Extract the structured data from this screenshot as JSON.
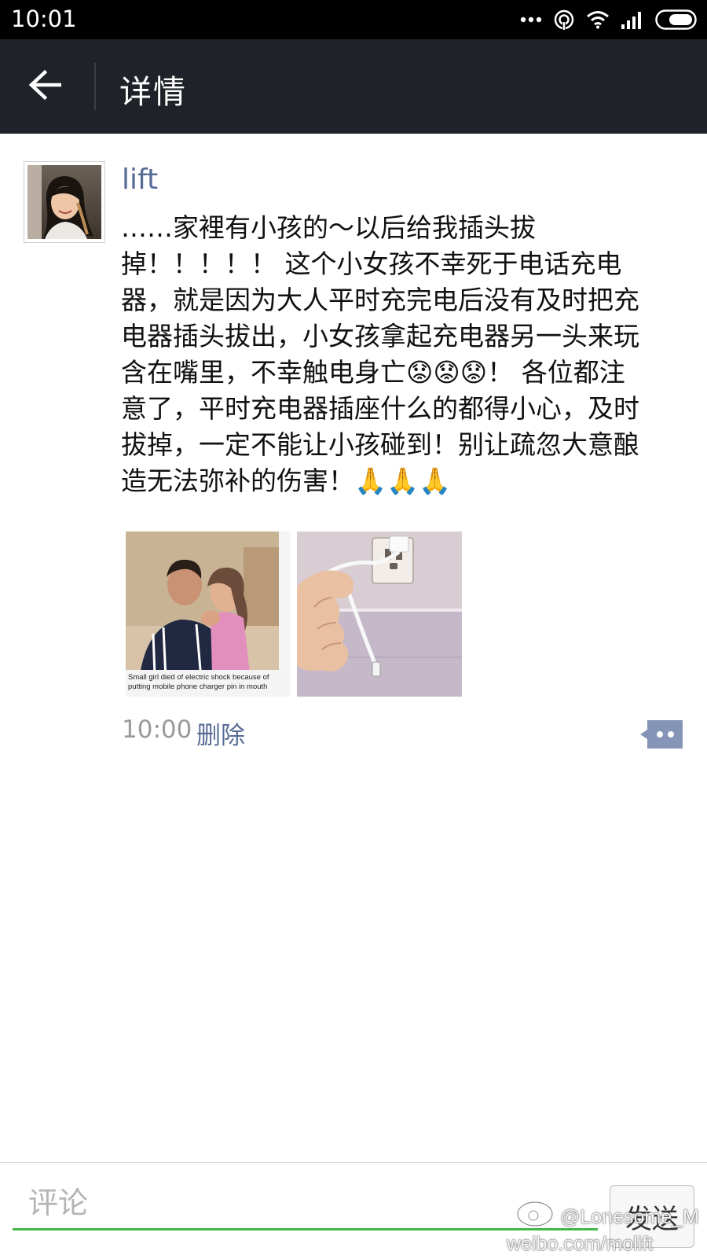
{
  "status_bar": {
    "time": "10:01",
    "icons": [
      "more-dots-icon",
      "hotspot-icon",
      "wifi-icon",
      "signal-icon",
      "battery-icon"
    ]
  },
  "header": {
    "title": "详情"
  },
  "post": {
    "author": "lift",
    "text": "……家裡有小孩的～以后给我插头拔\n掉！！！！！ 这个小女孩不幸死于电话充电\n器，就是因为大人平时充完电后没有及时把充\n电器插头拔出，小女孩拿起充电器另一头来玩\n含在嘴里，不幸触电身亡😟😟😟！ 各位都注\n意了，平时充电器插座什么的都得小心，及时\n拔掉，一定不能让小孩碰到！别让疏忽大意酿\n造无法弥补的伤害！🙏🙏🙏",
    "photos": [
      {
        "name": "photo-father-daughter",
        "caption": "Small girl died of electric shock because of putting mobile phone charger pin in mouth"
      },
      {
        "name": "photo-charger-cable"
      }
    ],
    "time": "10:00",
    "delete_label": "删除"
  },
  "comment_bar": {
    "placeholder": "评论",
    "send_label": "发送"
  },
  "watermark": {
    "handle": "@Lonesome_M",
    "url": "weibo.com/molift"
  },
  "colors": {
    "status_bar_bg": "#000000",
    "app_bar_bg": "#1f2329",
    "link_blue": "#576b95",
    "input_underline_green": "#45b649",
    "time_gray": "#9a9a9a"
  }
}
